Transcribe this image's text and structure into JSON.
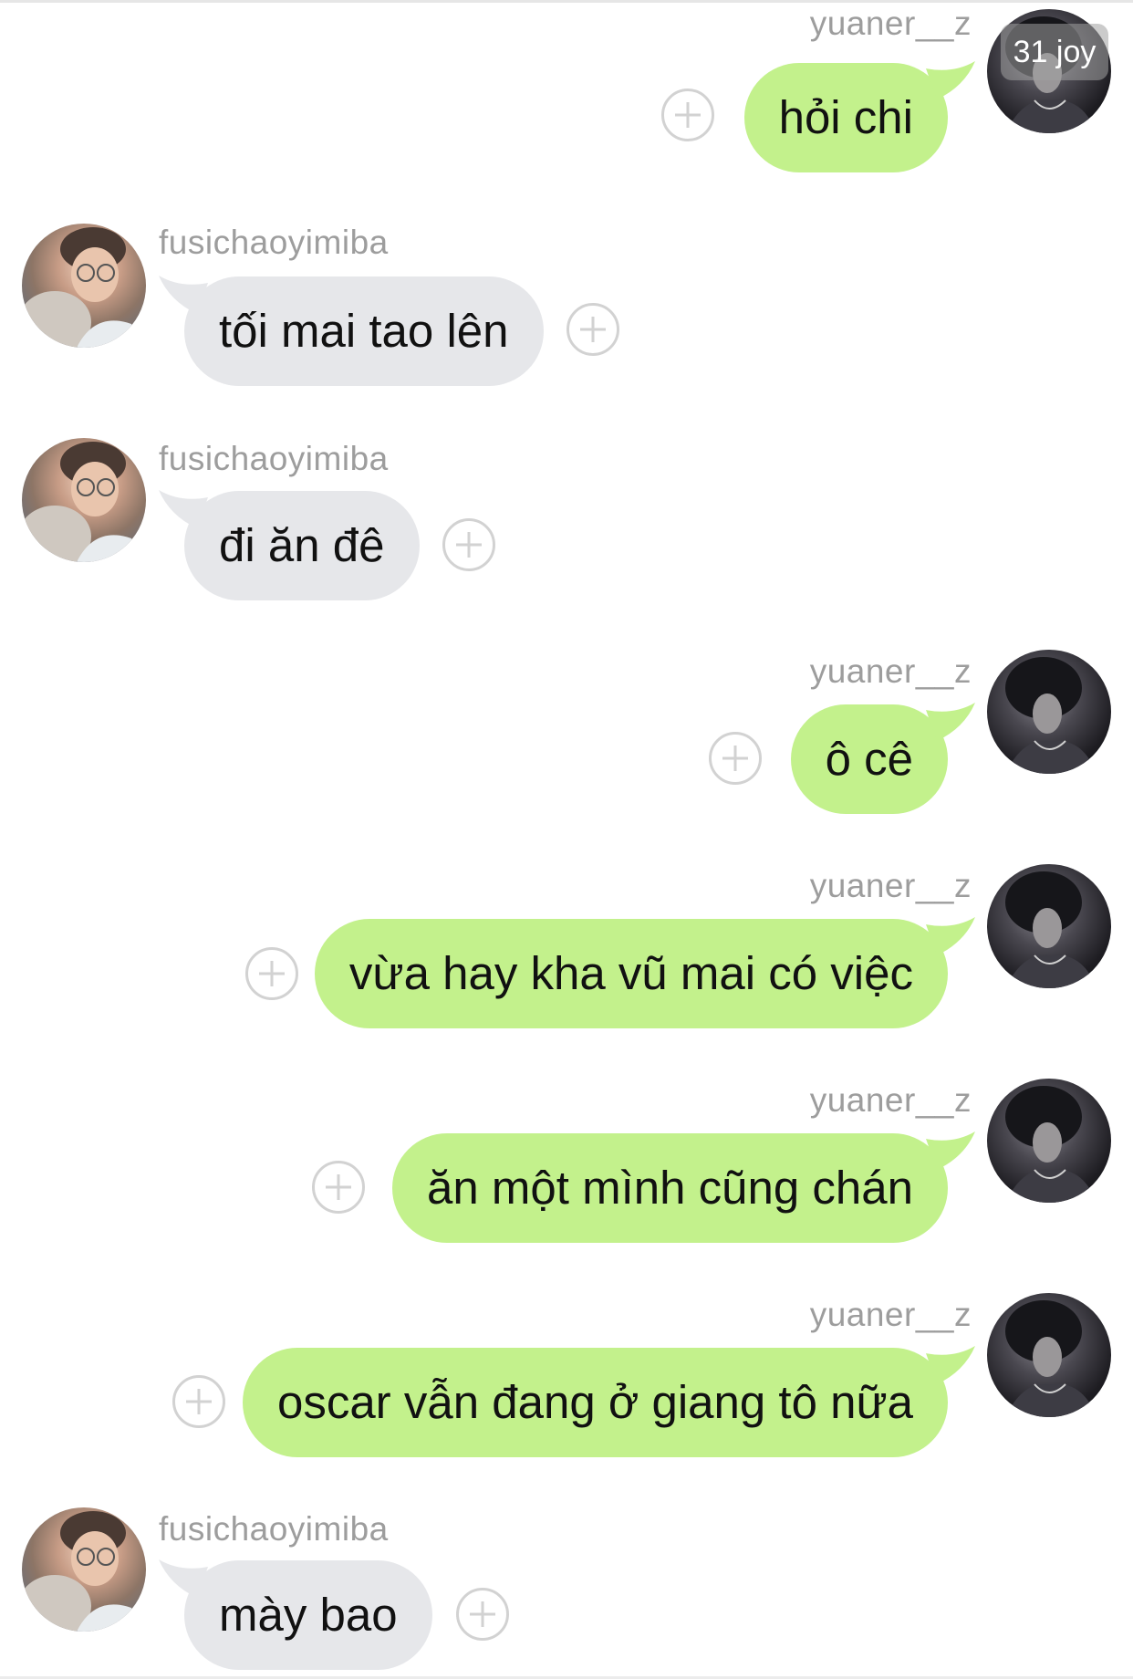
{
  "watermark": "31 joy",
  "messages": [
    {
      "sender": "yuaner__z",
      "text": "hỏi chi",
      "side": "right"
    },
    {
      "sender": "fusichaoyimiba",
      "text": "tối mai tao lên",
      "side": "left"
    },
    {
      "sender": "fusichaoyimiba",
      "text": "đi ăn đê",
      "side": "left"
    },
    {
      "sender": "yuaner__z",
      "text": "ô cê",
      "side": "right"
    },
    {
      "sender": "yuaner__z",
      "text": "vừa hay kha vũ mai có việc",
      "side": "right"
    },
    {
      "sender": "yuaner__z",
      "text": "ăn một mình cũng chán",
      "side": "right"
    },
    {
      "sender": "yuaner__z",
      "text": "oscar vẫn đang ở giang tô nữa",
      "side": "right"
    },
    {
      "sender": "fusichaoyimiba",
      "text": "mày bao",
      "side": "left"
    }
  ],
  "colors": {
    "my_bubble": "#c3f18c",
    "their_bubble": "#e6e7ea",
    "name_text": "#9d9d9d"
  },
  "icons": {
    "add": "plus-circle-icon",
    "avatar_me": "avatar-dark-photo",
    "avatar_them": "avatar-light-photo"
  }
}
